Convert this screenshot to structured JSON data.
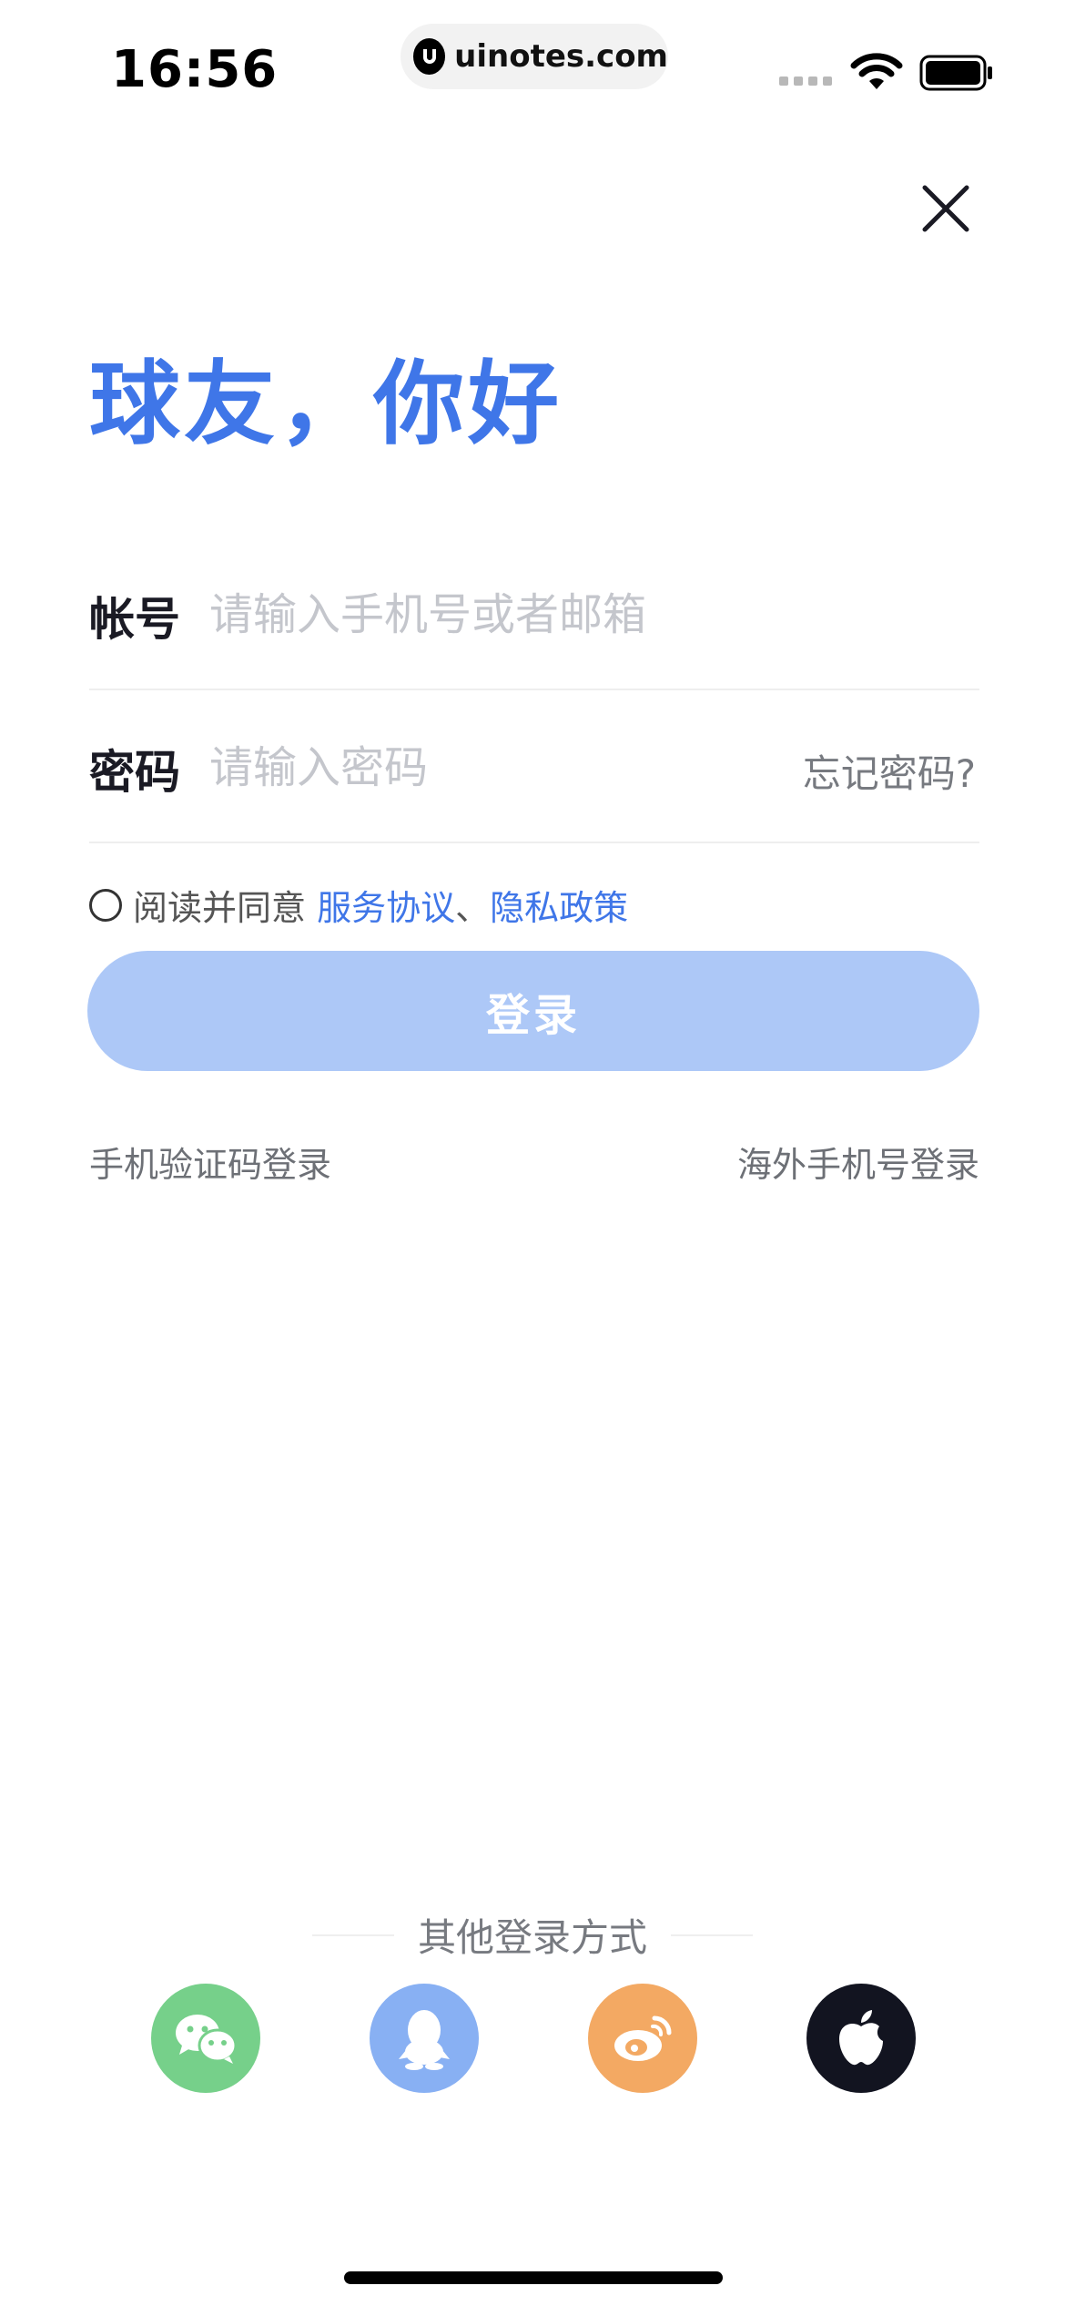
{
  "status_bar": {
    "time": "16:56",
    "url": "uinotes.com"
  },
  "header": {
    "greeting": "球友，你好"
  },
  "form": {
    "account_label": "帐号",
    "account_placeholder": "请输入手机号或者邮箱",
    "account_value": "",
    "password_label": "密码",
    "password_placeholder": "请输入密码",
    "password_value": "",
    "forgot_password": "忘记密码?",
    "agree_prefix": "阅读并同意 ",
    "terms_link": "服务协议",
    "separator": "、",
    "privacy_link": "隐私政策",
    "login_button": "登录"
  },
  "alt_login": {
    "sms_login": "手机验证码登录",
    "overseas_login": "海外手机号登录"
  },
  "social_login": {
    "title": "其他登录方式",
    "providers": [
      {
        "icon": "wechat-icon",
        "color": "#76d08a"
      },
      {
        "icon": "qq-icon",
        "color": "#88b0f3"
      },
      {
        "icon": "weibo-icon",
        "color": "#f3a963"
      },
      {
        "icon": "apple-icon",
        "color": "#121420"
      }
    ]
  },
  "colors": {
    "accent": "#3f76e8",
    "button_disabled": "#adc8f7"
  }
}
